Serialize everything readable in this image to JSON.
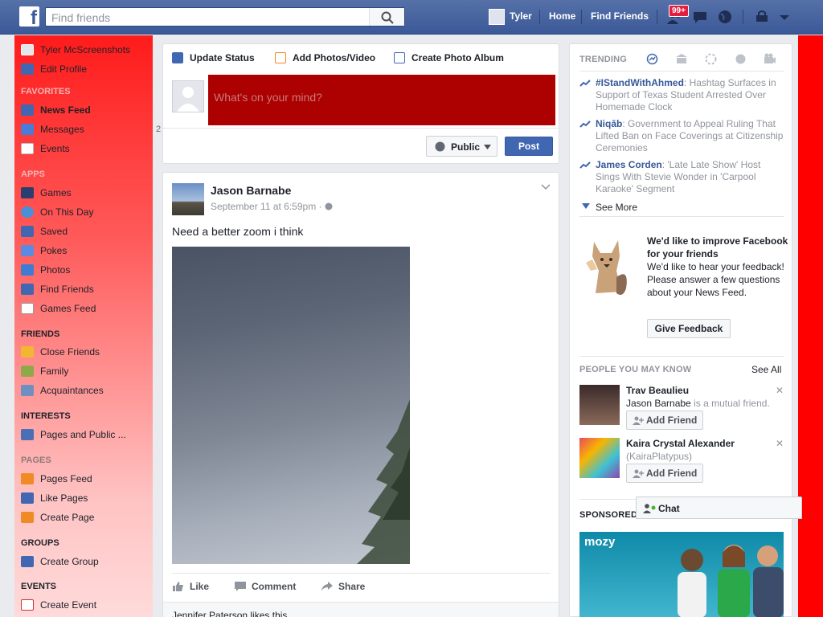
{
  "topbar": {
    "logo": "f",
    "search_placeholder": "Find friends",
    "user_name": "Tyler",
    "home": "Home",
    "find_friends": "Find Friends",
    "notif_badge": "99+"
  },
  "leftnav": {
    "profile_name": "Tyler McScreenshots",
    "edit_profile": "Edit Profile",
    "favorites_head": "FAVORITES",
    "favorites": [
      {
        "label": "News Feed"
      },
      {
        "label": "Messages",
        "count": "2"
      },
      {
        "label": "Events"
      }
    ],
    "apps_head": "APPS",
    "apps": [
      {
        "label": "Games"
      },
      {
        "label": "On This Day"
      },
      {
        "label": "Saved"
      },
      {
        "label": "Pokes"
      },
      {
        "label": "Photos"
      },
      {
        "label": "Find Friends"
      },
      {
        "label": "Games Feed"
      }
    ],
    "friends_head": "FRIENDS",
    "friends": [
      {
        "label": "Close Friends"
      },
      {
        "label": "Family"
      },
      {
        "label": "Acquaintances"
      }
    ],
    "interests_head": "INTERESTS",
    "interests": [
      {
        "label": "Pages and Public ..."
      }
    ],
    "pages_head": "PAGES",
    "pages": [
      {
        "label": "Pages Feed"
      },
      {
        "label": "Like Pages"
      },
      {
        "label": "Create Page"
      }
    ],
    "groups_head": "GROUPS",
    "groups": [
      {
        "label": "Create Group"
      }
    ],
    "events_head": "EVENTS",
    "events": [
      {
        "label": "Create Event"
      }
    ]
  },
  "composer": {
    "tab_status": "Update Status",
    "tab_photos": "Add Photos/Video",
    "tab_album": "Create Photo Album",
    "placeholder": "What's on your mind?",
    "audience": "Public",
    "post": "Post"
  },
  "post": {
    "author": "Jason Barnabe",
    "time": "September 11 at 6:59pm ·",
    "text": "Need a better zoom i think",
    "like": "Like",
    "comment": "Comment",
    "share": "Share",
    "likes": "Jennifer Paterson likes this."
  },
  "rightcol": {
    "trending_head": "TRENDING",
    "trends": [
      {
        "topic": "#IStandWithAhmed",
        "desc": ": Hashtag Surfaces in Support of Texas Student Arrested Over Homemade Clock"
      },
      {
        "topic": "Niqāb",
        "desc": ": Government to Appeal Ruling That Lifted Ban on Face Coverings at Citizenship Ceremonies"
      },
      {
        "topic": "James Corden",
        "desc": ": 'Late Late Show' Host Sings With Stevie Wonder in 'Carpool Karaoke' Segment"
      }
    ],
    "see_more": "See More",
    "feedback_title": "We'd like to improve Facebook for your friends",
    "feedback_body": "We'd like to hear your feedback! Please answer a few questions about your News Feed.",
    "feedback_btn": "Give Feedback",
    "pymk_head": "PEOPLE YOU MAY KNOW",
    "see_all": "See All",
    "people": [
      {
        "name": "Trav Beaulieu",
        "mutual_name": "Jason Barnabe",
        "mutual_suffix": " is a mutual friend.",
        "add": "Add Friend"
      },
      {
        "name": "Kaira Crystal Alexander",
        "sub": "(KairaPlatypus)",
        "add": "Add Friend"
      }
    ],
    "sponsored_head": "SPONSORED",
    "ad_logo": "mozy"
  },
  "chat": {
    "label": "Chat"
  },
  "colors": {
    "brand": "#3b5998",
    "leftnav_top": "#ff1b1b",
    "composer_field": "#ad0000"
  }
}
